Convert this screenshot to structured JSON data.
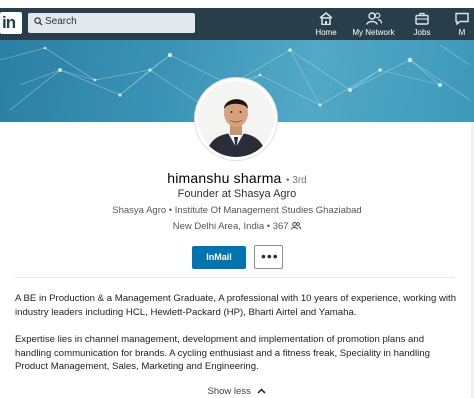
{
  "nav": {
    "logo_text": "in",
    "search_placeholder": "Search",
    "items": [
      {
        "label": "Home",
        "icon": "home-icon"
      },
      {
        "label": "My Network",
        "icon": "people-icon"
      },
      {
        "label": "Jobs",
        "icon": "briefcase-icon"
      },
      {
        "label": "M",
        "icon": "message-icon"
      }
    ]
  },
  "colors": {
    "nav_bg": "#283e4a",
    "accent": "#0073b1",
    "banner": "#3a93b6"
  },
  "profile": {
    "name": "himanshu sharma",
    "degree": "• 3rd",
    "headline": "Founder at Shasya Agro",
    "company": "Shasya Agro",
    "school": "Institute Of Management Studies Ghaziabad",
    "location": "New Delhi Area, India",
    "connections": "367"
  },
  "actions": {
    "inmail_label": "InMail",
    "more_label": "•••"
  },
  "summary": {
    "para1": "A BE in Production & a Management Graduate, A professional with 10 years of experience, working with industry leaders including HCL, Hewlett-Packard (HP), Bharti Airtel and Yamaha.",
    "para2": "Expertise lies in channel management, development and implementation of promotion plans and handling communication for brands. A cycling enthusiast and a fitness freak, Speciality in handling Product Management, Sales, Marketing and Engineering.",
    "show_less": "Show less"
  }
}
